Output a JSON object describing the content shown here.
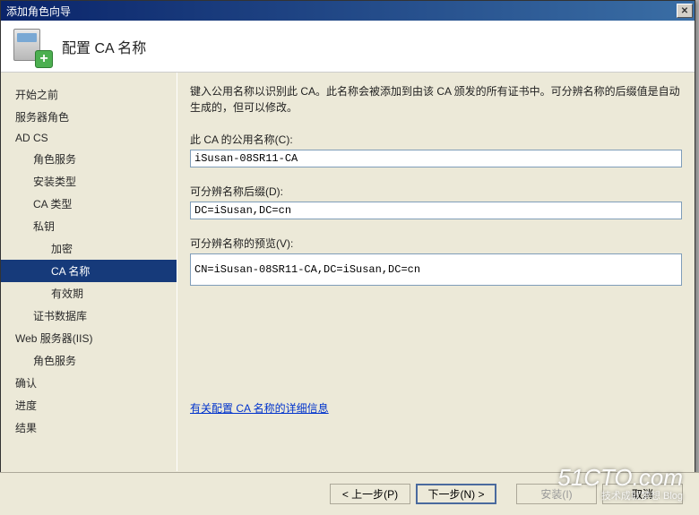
{
  "titlebar": {
    "title": "添加角色向导",
    "close": "✕"
  },
  "header": {
    "title": "配置 CA 名称"
  },
  "sidebar": {
    "items": [
      {
        "label": "开始之前",
        "indent": 0
      },
      {
        "label": "服务器角色",
        "indent": 0
      },
      {
        "label": "AD CS",
        "indent": 0
      },
      {
        "label": "角色服务",
        "indent": 1
      },
      {
        "label": "安装类型",
        "indent": 1
      },
      {
        "label": "CA 类型",
        "indent": 1
      },
      {
        "label": "私钥",
        "indent": 1
      },
      {
        "label": "加密",
        "indent": 2
      },
      {
        "label": "CA 名称",
        "indent": 2,
        "selected": true
      },
      {
        "label": "有效期",
        "indent": 2
      },
      {
        "label": "证书数据库",
        "indent": 1
      },
      {
        "label": "Web 服务器(IIS)",
        "indent": 0
      },
      {
        "label": "角色服务",
        "indent": 1
      },
      {
        "label": "确认",
        "indent": 0
      },
      {
        "label": "进度",
        "indent": 0
      },
      {
        "label": "结果",
        "indent": 0
      }
    ]
  },
  "content": {
    "intro": "键入公用名称以识别此 CA。此名称会被添加到由该 CA 颁发的所有证书中。可分辨名称的后缀值是自动生成的，但可以修改。",
    "common_name_label": "此 CA 的公用名称(C):",
    "common_name_value": "iSusan-08SR11-CA",
    "dn_suffix_label": "可分辨名称后缀(D):",
    "dn_suffix_value": "DC=iSusan,DC=cn",
    "dn_preview_label": "可分辨名称的预览(V):",
    "dn_preview_value": "CN=iSusan-08SR11-CA,DC=iSusan,DC=cn",
    "link": "有关配置 CA 名称的详细信息"
  },
  "footer": {
    "prev": "< 上一步(P)",
    "next": "下一步(N) >",
    "install": "安装(I)",
    "cancel": "取消"
  },
  "watermark": {
    "main": "51CTO.com",
    "sub": "技术成就梦想   Blog"
  }
}
